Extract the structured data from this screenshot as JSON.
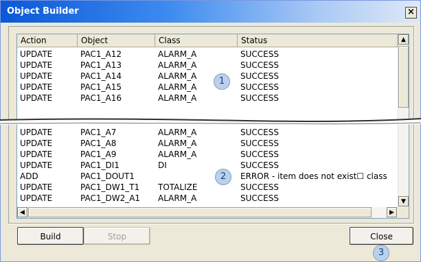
{
  "window": {
    "title": "Object Builder",
    "close_glyph": "×"
  },
  "columns": [
    "Action",
    "Object",
    "Class",
    "Status"
  ],
  "rows_top": [
    [
      "UPDATE",
      "PAC1_A12",
      "ALARM_A",
      "SUCCESS"
    ],
    [
      "UPDATE",
      "PAC1_A13",
      "ALARM_A",
      "SUCCESS"
    ],
    [
      "UPDATE",
      "PAC1_A14",
      "ALARM_A",
      "SUCCESS"
    ],
    [
      "UPDATE",
      "PAC1_A15",
      "ALARM_A",
      "SUCCESS"
    ],
    [
      "UPDATE",
      "PAC1_A16",
      "ALARM_A",
      "SUCCESS"
    ]
  ],
  "rows_bottom": [
    [
      "UPDATE",
      "PAC1_A7",
      "ALARM_A",
      "SUCCESS"
    ],
    [
      "UPDATE",
      "PAC1_A8",
      "ALARM_A",
      "SUCCESS"
    ],
    [
      "UPDATE",
      "PAC1_A9",
      "ALARM_A",
      "SUCCESS"
    ],
    [
      "UPDATE",
      "PAC1_DI1",
      "DI",
      "SUCCESS"
    ],
    [
      "ADD",
      "PAC1_DOUT1",
      "",
      "ERROR - item does not exist☐ class"
    ],
    [
      "UPDATE",
      "PAC1_DW1_T1",
      "TOTALIZE",
      "SUCCESS"
    ],
    [
      "UPDATE",
      "PAC1_DW2_A1",
      "ALARM_A",
      "SUCCESS"
    ]
  ],
  "buttons": {
    "build": "Build",
    "stop": "Stop",
    "close": "Close"
  },
  "scroll_arrows": {
    "up": "▲",
    "down": "▼",
    "left": "◀",
    "right": "▶"
  },
  "callouts": [
    "1",
    "2",
    "3"
  ],
  "colors": {
    "title_bar": "#0a58d6",
    "callout": "#b9d1ea",
    "dialog": "#ece9d8"
  }
}
